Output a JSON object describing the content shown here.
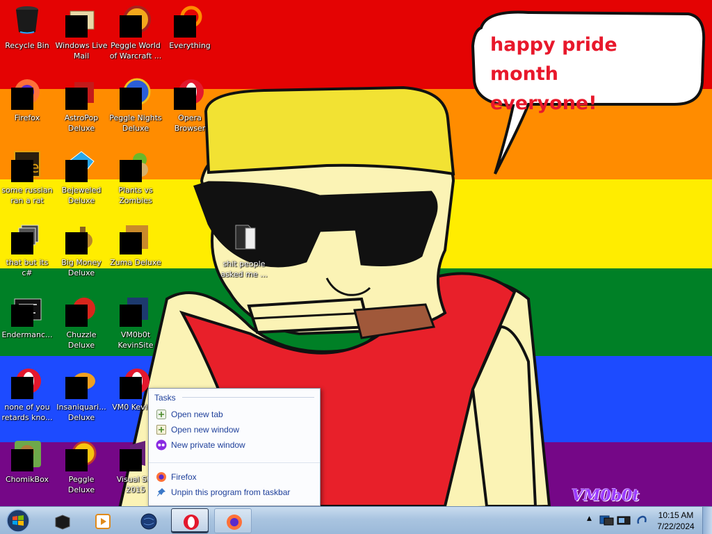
{
  "wallpaper": {
    "speech_line1": "happy pride month",
    "speech_line2": "everyone!",
    "watermark": "VM0b0t",
    "stripe_colors": [
      "#e40303",
      "#ff8c00",
      "#ffed00",
      "#008026",
      "#1d4bff",
      "#750787"
    ]
  },
  "desktop": {
    "icons": [
      {
        "label": "Recycle Bin",
        "icon": "recycle-bin-icon"
      },
      {
        "label": "Windows Live Mail",
        "icon": "mail-icon"
      },
      {
        "label": "Peggle World of Warcraft ...",
        "icon": "peggle-wow-icon"
      },
      {
        "label": "Everything",
        "icon": "everything-search-icon"
      },
      {
        "label": "Firefox",
        "icon": "firefox-icon"
      },
      {
        "label": "AstroPop Deluxe",
        "icon": "astropop-icon"
      },
      {
        "label": "Peggle Nights Deluxe",
        "icon": "peggle-nights-icon"
      },
      {
        "label": "Opera Browser",
        "icon": "opera-icon"
      },
      {
        "label": "some russian ran a rat",
        "icon": "file-icon"
      },
      {
        "label": "Bejeweled Deluxe",
        "icon": "bejeweled-icon"
      },
      {
        "label": "Plants vs Zombies",
        "icon": "plants-vs-zombies-icon"
      },
      {
        "label": "that but its c#",
        "icon": "folder-stack-icon"
      },
      {
        "label": "Big Money Deluxe",
        "icon": "money-bag-icon"
      },
      {
        "label": "Zuma Deluxe",
        "icon": "zuma-icon"
      },
      {
        "label": "Endermanc...",
        "icon": "app-window-icon"
      },
      {
        "label": "Chuzzle Deluxe",
        "icon": "chuzzle-icon"
      },
      {
        "label": "VM0b0t KevinSite",
        "icon": "site-icon"
      },
      {
        "label": "none of you retards kno...",
        "icon": "opera-icon"
      },
      {
        "label": "Insaniquari... Deluxe",
        "icon": "insaniquarium-icon"
      },
      {
        "label": "VM0 KevinSi",
        "icon": "opera-icon"
      },
      {
        "label": "ChomikBox",
        "icon": "chomikbox-icon"
      },
      {
        "label": "Peggle Deluxe",
        "icon": "peggle-icon"
      },
      {
        "label": "Visual Stu 2015",
        "icon": "visual-studio-icon"
      },
      {
        "label": "shit people asked me ...",
        "icon": "folder-icon"
      }
    ]
  },
  "jumplist": {
    "tasks_header": "Tasks",
    "tasks": [
      {
        "label": "Open new tab",
        "icon": "new-tab-icon"
      },
      {
        "label": "Open new window",
        "icon": "new-window-icon"
      },
      {
        "label": "New private window",
        "icon": "private-window-icon"
      }
    ],
    "program": {
      "label": "Firefox",
      "icon": "firefox-icon"
    },
    "unpin": {
      "label": "Unpin this program from taskbar",
      "icon": "unpin-icon"
    }
  },
  "taskbar": {
    "start_icon": "windows-orb-icon",
    "pinned": [
      {
        "name": "media-player-icon"
      },
      {
        "name": "media-center-icon"
      },
      {
        "name": "globe-icon"
      },
      {
        "name": "opera-icon"
      },
      {
        "name": "firefox-icon"
      }
    ],
    "clock_time": "10:15 AM",
    "clock_date": "7/22/2024",
    "tray_icons": [
      "network-icon",
      "volume-icon",
      "action-center-icon"
    ]
  }
}
